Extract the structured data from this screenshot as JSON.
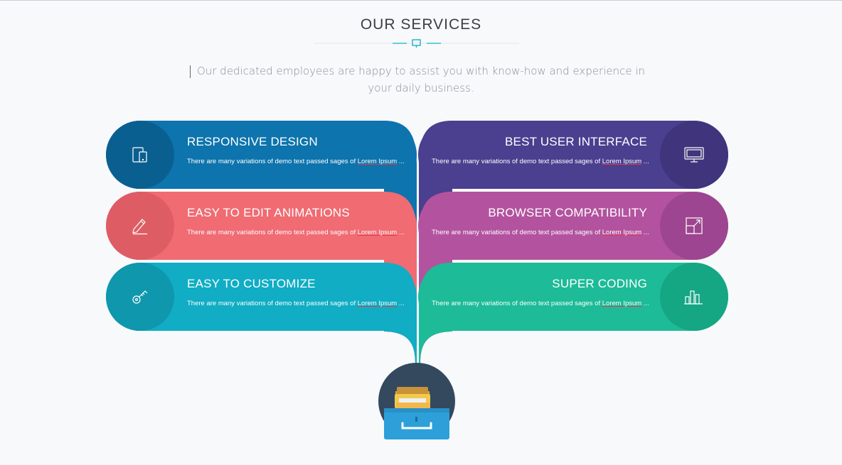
{
  "section": {
    "title": "OUR SERVICES",
    "subtitle": "Our dedicated employees are happy to assist you with know-how and experience in your daily business."
  },
  "services": [
    {
      "title": "RESPONSIVE DESIGN",
      "text_prefix": "There are many variations of demo text passed sages of ",
      "lorem": "Lorem Ipsum",
      "ellipsis": " ...",
      "icon": "devices-icon",
      "color": "#0d74ad",
      "circle_color": "#0a5f91"
    },
    {
      "title": "EASY TO EDIT ANIMATIONS",
      "text_prefix": "There are many variations of demo text passed sages of ",
      "lorem": "Lorem Ipsum",
      "ellipsis": " ...",
      "icon": "pencil-icon",
      "color": "#f06b72",
      "circle_color": "#de5d65"
    },
    {
      "title": "EASY TO CUSTOMIZE",
      "text_prefix": "There are many variations of demo text passed sages of ",
      "lorem": "Lorem Ipsum",
      "ellipsis": " ...",
      "icon": "key-icon",
      "color": "#10adc4",
      "circle_color": "#0e97ad"
    },
    {
      "title": "BEST USER INTERFACE",
      "text_prefix": "There are many variations of demo text passed sages of ",
      "lorem": "Lorem Ipsum",
      "ellipsis": " ...",
      "icon": "monitor-icon",
      "color": "#4b3f8f",
      "circle_color": "#40357c"
    },
    {
      "title": "BROWSER COMPATIBILITY",
      "text_prefix": "There are many variations of demo text passed sages of ",
      "lorem": "Lorem Ipsum",
      "ellipsis": " ...",
      "icon": "resize-icon",
      "color": "#b3539f",
      "circle_color": "#9d4590"
    },
    {
      "title": "SUPER CODING",
      "text_prefix": "There are many variations of demo text passed sages of ",
      "lorem": "Lorem Ipsum",
      "ellipsis": " ...",
      "icon": "bar-chart-icon",
      "color": "#1dbb98",
      "circle_color": "#15a684"
    }
  ],
  "footer_icon": "file-drawer-icon"
}
